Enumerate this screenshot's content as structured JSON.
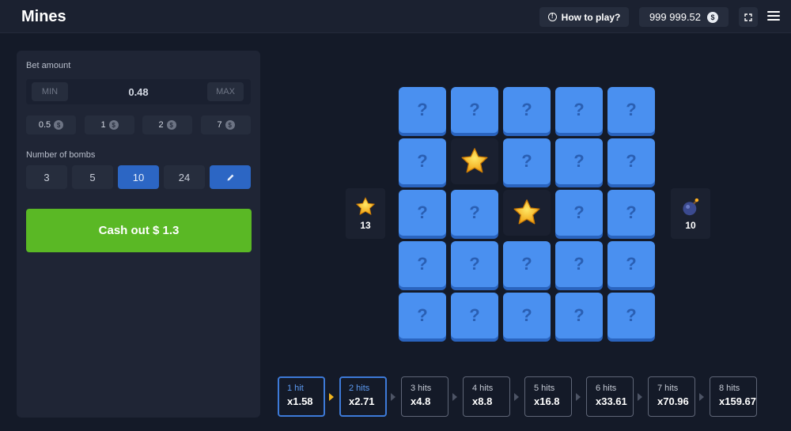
{
  "header": {
    "title": "Mines",
    "how_to_play": "How to play?",
    "balance": "999 999.52",
    "currency_icon": "$"
  },
  "panel": {
    "bet_label": "Bet amount",
    "min_label": "MIN",
    "bet_value": "0.48",
    "max_label": "MAX",
    "chips": [
      "0.5",
      "1",
      "2",
      "7"
    ],
    "bombs_label": "Number of bombs",
    "bomb_options": [
      "3",
      "5",
      "10",
      "24"
    ],
    "selected_bombs": "10",
    "cashout_label": "Cash out $ 1.3"
  },
  "board": {
    "hidden_symbol": "?",
    "rows": [
      [
        "hidden",
        "hidden",
        "hidden",
        "hidden",
        "hidden"
      ],
      [
        "hidden",
        "star",
        "hidden",
        "hidden",
        "hidden"
      ],
      [
        "hidden",
        "hidden",
        "star",
        "hidden",
        "hidden"
      ],
      [
        "hidden",
        "hidden",
        "hidden",
        "hidden",
        "hidden"
      ],
      [
        "hidden",
        "hidden",
        "hidden",
        "hidden",
        "hidden"
      ]
    ],
    "stars_left": "13",
    "bombs_count": "10"
  },
  "multipliers": [
    {
      "hits": "1 hit",
      "value": "x1.58"
    },
    {
      "hits": "2 hits",
      "value": "x2.71"
    },
    {
      "hits": "3 hits",
      "value": "x4.8"
    },
    {
      "hits": "4 hits",
      "value": "x8.8"
    },
    {
      "hits": "5 hits",
      "value": "x16.8"
    },
    {
      "hits": "6 hits",
      "value": "x33.61"
    },
    {
      "hits": "7 hits",
      "value": "x70.96"
    },
    {
      "hits": "8 hits",
      "value": "x159.67"
    }
  ],
  "colors": {
    "background": "#141a28",
    "tile_blue": "#4a90f0",
    "accent_blue": "#2c66c4",
    "cashout_green": "#5ab825",
    "star_gold": "#f2b51e"
  }
}
